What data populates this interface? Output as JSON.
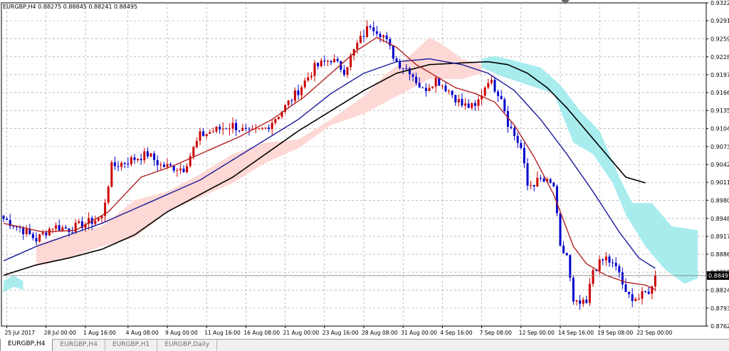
{
  "chart_header": "EURGBP,H4  0.88275 0.88845 0.88241 0.88495",
  "tabs": [
    {
      "label": "EURGBP,H4",
      "active": true
    },
    {
      "label": "EURGBP,H4",
      "active": false
    },
    {
      "label": "EURGBP,H1",
      "active": false
    },
    {
      "label": "EURGBP,Daily",
      "active": false
    }
  ],
  "colors": {
    "bull": "#cc0000",
    "bear": "#0000cc",
    "ma_fast": "#b22222",
    "ma_mid": "#1a1a99",
    "ma_slow": "#000000",
    "cloud_bull": "#fdd8d4",
    "cloud_bear": "#a8ecee",
    "grid": "#9a9a9a",
    "price_label_bg": "#000000"
  },
  "chart_data": {
    "type": "candlestick",
    "symbol": "EURGBP",
    "timeframe": "H4",
    "current_price": "0.88495",
    "ylim": [
      0.8762,
      0.9322
    ],
    "y_ticks": [
      "0.93220",
      "0.92910",
      "0.92595",
      "0.92285",
      "0.91975",
      "0.91665",
      "0.91355",
      "0.91040",
      "0.90730",
      "0.90420",
      "0.90110",
      "0.89800",
      "0.89485",
      "0.89175",
      "0.88865",
      "0.88555",
      "0.88245",
      "0.87930",
      "0.87620"
    ],
    "x_ticks": [
      {
        "bar": 1,
        "label": "25 Jul 2017"
      },
      {
        "bar": 13,
        "label": "28 Jul 00:00"
      },
      {
        "bar": 25,
        "label": "1 Aug 16:00"
      },
      {
        "bar": 38,
        "label": "4 Aug 08:00"
      },
      {
        "bar": 50,
        "label": "9 Aug 00:00"
      },
      {
        "bar": 62,
        "label": "11 Aug 16:00"
      },
      {
        "bar": 74,
        "label": "16 Aug 08:00"
      },
      {
        "bar": 86,
        "label": "21 Aug 00:00"
      },
      {
        "bar": 98,
        "label": "23 Aug 16:00"
      },
      {
        "bar": 110,
        "label": "28 Aug 08:00"
      },
      {
        "bar": 122,
        "label": "31 Aug 00:00"
      },
      {
        "bar": 134,
        "label": "4 Sep 16:00"
      },
      {
        "bar": 146,
        "label": "7 Sep 08:00"
      },
      {
        "bar": 158,
        "label": "12 Sep 00:00"
      },
      {
        "bar": 170,
        "label": "14 Sep 16:00"
      },
      {
        "bar": 182,
        "label": "19 Sep 08:00"
      },
      {
        "bar": 194,
        "label": "22 Sep 00:00"
      }
    ],
    "close_anchors": [
      [
        0,
        0.8948
      ],
      [
        5,
        0.8932
      ],
      [
        10,
        0.8912
      ],
      [
        15,
        0.8935
      ],
      [
        20,
        0.893
      ],
      [
        25,
        0.894
      ],
      [
        30,
        0.895
      ],
      [
        33,
        0.9038
      ],
      [
        38,
        0.9048
      ],
      [
        44,
        0.906
      ],
      [
        48,
        0.904
      ],
      [
        55,
        0.9035
      ],
      [
        60,
        0.9092
      ],
      [
        65,
        0.9102
      ],
      [
        70,
        0.911
      ],
      [
        75,
        0.9095
      ],
      [
        80,
        0.9105
      ],
      [
        85,
        0.9135
      ],
      [
        90,
        0.917
      ],
      [
        95,
        0.921
      ],
      [
        100,
        0.9225
      ],
      [
        104,
        0.9205
      ],
      [
        108,
        0.925
      ],
      [
        112,
        0.9285
      ],
      [
        116,
        0.9265
      ],
      [
        120,
        0.922
      ],
      [
        124,
        0.9205
      ],
      [
        128,
        0.917
      ],
      [
        132,
        0.919
      ],
      [
        136,
        0.917
      ],
      [
        140,
        0.9145
      ],
      [
        144,
        0.914
      ],
      [
        148,
        0.919
      ],
      [
        152,
        0.916
      ],
      [
        154,
        0.9115
      ],
      [
        158,
        0.907
      ],
      [
        160,
        0.9005
      ],
      [
        164,
        0.9015
      ],
      [
        168,
        0.9005
      ],
      [
        170,
        0.8895
      ],
      [
        172,
        0.8885
      ],
      [
        174,
        0.88
      ],
      [
        178,
        0.88
      ],
      [
        180,
        0.886
      ],
      [
        184,
        0.888
      ],
      [
        188,
        0.8855
      ],
      [
        190,
        0.8815
      ],
      [
        194,
        0.881
      ],
      [
        198,
        0.8828
      ],
      [
        199,
        0.885
      ]
    ],
    "ma_fast": [
      [
        0,
        0.894
      ],
      [
        12,
        0.8925
      ],
      [
        22,
        0.8928
      ],
      [
        32,
        0.896
      ],
      [
        42,
        0.902
      ],
      [
        52,
        0.904
      ],
      [
        62,
        0.9065
      ],
      [
        72,
        0.909
      ],
      [
        82,
        0.912
      ],
      [
        92,
        0.916
      ],
      [
        102,
        0.921
      ],
      [
        108,
        0.924
      ],
      [
        114,
        0.9262
      ],
      [
        120,
        0.9245
      ],
      [
        126,
        0.9215
      ],
      [
        132,
        0.9195
      ],
      [
        138,
        0.9175
      ],
      [
        144,
        0.9165
      ],
      [
        150,
        0.915
      ],
      [
        156,
        0.911
      ],
      [
        162,
        0.9055
      ],
      [
        168,
        0.899
      ],
      [
        174,
        0.89
      ],
      [
        178,
        0.887
      ],
      [
        184,
        0.885
      ],
      [
        190,
        0.8838
      ],
      [
        196,
        0.8833
      ],
      [
        199,
        0.8825
      ]
    ],
    "ma_mid": [
      [
        0,
        0.8875
      ],
      [
        10,
        0.89
      ],
      [
        20,
        0.892
      ],
      [
        30,
        0.894
      ],
      [
        40,
        0.8965
      ],
      [
        50,
        0.899
      ],
      [
        60,
        0.9015
      ],
      [
        70,
        0.905
      ],
      [
        80,
        0.9085
      ],
      [
        90,
        0.912
      ],
      [
        100,
        0.9165
      ],
      [
        110,
        0.92
      ],
      [
        120,
        0.922
      ],
      [
        130,
        0.9225
      ],
      [
        140,
        0.9215
      ],
      [
        148,
        0.92
      ],
      [
        156,
        0.917
      ],
      [
        164,
        0.912
      ],
      [
        172,
        0.906
      ],
      [
        180,
        0.8995
      ],
      [
        188,
        0.8925
      ],
      [
        194,
        0.888
      ],
      [
        199,
        0.8862
      ]
    ],
    "ma_slow": [
      [
        0,
        0.885
      ],
      [
        10,
        0.8868
      ],
      [
        20,
        0.888
      ],
      [
        30,
        0.8895
      ],
      [
        40,
        0.892
      ],
      [
        50,
        0.896
      ],
      [
        60,
        0.899
      ],
      [
        70,
        0.902
      ],
      [
        80,
        0.906
      ],
      [
        90,
        0.91
      ],
      [
        100,
        0.9135
      ],
      [
        110,
        0.917
      ],
      [
        120,
        0.92
      ],
      [
        130,
        0.9215
      ],
      [
        140,
        0.9218
      ],
      [
        148,
        0.922
      ],
      [
        154,
        0.9215
      ],
      [
        160,
        0.92
      ],
      [
        166,
        0.9175
      ],
      [
        172,
        0.914
      ],
      [
        178,
        0.91
      ],
      [
        184,
        0.906
      ],
      [
        190,
        0.902
      ],
      [
        196,
        0.901
      ]
    ],
    "cloud_bull": [
      {
        "top": [
          [
            10,
            0.8905
          ],
          [
            20,
            0.892
          ],
          [
            30,
            0.8935
          ],
          [
            40,
            0.898
          ],
          [
            50,
            0.8995
          ],
          [
            60,
            0.9025
          ],
          [
            70,
            0.906
          ],
          [
            80,
            0.908
          ],
          [
            90,
            0.9085
          ],
          [
            100,
            0.912
          ],
          [
            110,
            0.916
          ],
          [
            116,
            0.9195
          ],
          [
            124,
            0.923
          ],
          [
            130,
            0.9262
          ],
          [
            134,
            0.925
          ],
          [
            140,
            0.9225
          ],
          [
            146,
            0.9215
          ]
        ],
        "bottom": [
          [
            10,
            0.8865
          ],
          [
            20,
            0.888
          ],
          [
            30,
            0.89
          ],
          [
            40,
            0.8915
          ],
          [
            50,
            0.896
          ],
          [
            60,
            0.8985
          ],
          [
            70,
            0.901
          ],
          [
            80,
            0.9045
          ],
          [
            90,
            0.907
          ],
          [
            100,
            0.911
          ],
          [
            110,
            0.913
          ],
          [
            120,
            0.916
          ],
          [
            130,
            0.919
          ],
          [
            140,
            0.919
          ],
          [
            146,
            0.92
          ]
        ]
      }
    ],
    "cloud_bear": [
      {
        "top": [
          [
            146,
            0.9225
          ],
          [
            150,
            0.923
          ],
          [
            156,
            0.9222
          ],
          [
            164,
            0.921
          ],
          [
            170,
            0.918
          ],
          [
            176,
            0.9135
          ],
          [
            182,
            0.91
          ],
          [
            188,
            0.902
          ],
          [
            192,
            0.8975
          ],
          [
            198,
            0.8975
          ],
          [
            204,
            0.8935
          ],
          [
            212,
            0.8928
          ]
        ],
        "bottom": [
          [
            146,
            0.921
          ],
          [
            152,
            0.9195
          ],
          [
            160,
            0.918
          ],
          [
            168,
            0.9165
          ],
          [
            174,
            0.908
          ],
          [
            180,
            0.906
          ],
          [
            186,
            0.901
          ],
          [
            190,
            0.8955
          ],
          [
            196,
            0.89
          ],
          [
            202,
            0.886
          ],
          [
            208,
            0.8835
          ],
          [
            212,
            0.8845
          ]
        ]
      },
      {
        "top": [
          [
            0,
            0.884
          ],
          [
            3,
            0.885
          ],
          [
            6,
            0.884
          ]
        ],
        "bottom": [
          [
            0,
            0.882
          ],
          [
            3,
            0.883
          ],
          [
            6,
            0.8825
          ]
        ]
      }
    ],
    "legend": "none",
    "grid": true
  }
}
